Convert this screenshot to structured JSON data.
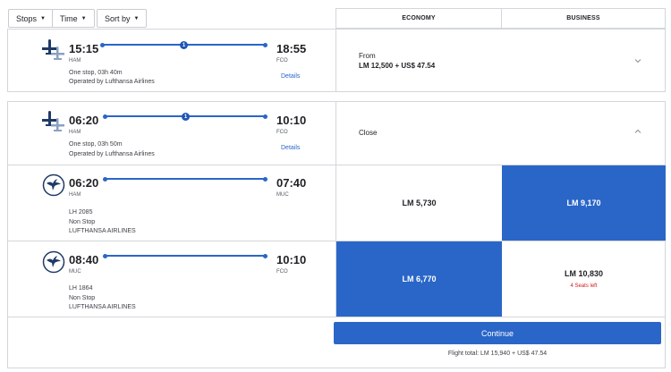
{
  "filters": {
    "stops_label": "Stops",
    "time_label": "Time",
    "sort_label": "Sort by"
  },
  "columns": {
    "economy": "ECONOMY",
    "business": "BUSINESS"
  },
  "flight1": {
    "depart_time": "15:15",
    "depart_code": "HAM",
    "arrive_time": "18:55",
    "arrive_code": "FCO",
    "stops_count": "1",
    "summary": "One stop, 03h 40m",
    "operator": "Operated by Lufthansa Airlines",
    "details_link": "Details",
    "from_label": "From",
    "from_price": "LM 12,500 + US$ 47.54"
  },
  "flight2": {
    "depart_time": "06:20",
    "depart_code": "HAM",
    "arrive_time": "10:10",
    "arrive_code": "FCO",
    "stops_count": "1",
    "summary": "One stop, 03h 50m",
    "operator": "Operated by Lufthansa Airlines",
    "details_link": "Details",
    "close_label": "Close"
  },
  "segments": [
    {
      "depart_time": "06:20",
      "depart_code": "HAM",
      "arrive_time": "07:40",
      "arrive_code": "MUC",
      "flight_no": "LH 2085",
      "stop_text": "Non Stop",
      "airline": "LUFTHANSA AIRLINES",
      "economy_price": "LM 5,730",
      "business_price": "LM 9,170",
      "selected": "business"
    },
    {
      "depart_time": "08:40",
      "depart_code": "MUC",
      "arrive_time": "10:10",
      "arrive_code": "FCO",
      "flight_no": "LH 1864",
      "stop_text": "Non Stop",
      "airline": "LUFTHANSA AIRLINES",
      "economy_price": "LM 6,770",
      "business_price": "LM 10,830",
      "business_seats": "4 Seats left",
      "selected": "economy"
    }
  ],
  "footer": {
    "continue_label": "Continue",
    "total_text": "Flight total: LM 15,940 + US$ 47.54"
  },
  "colors": {
    "accent": "#2a66c8",
    "seats_warning": "#d31a1a",
    "border": "#d3d6da"
  },
  "icons": [
    "caret-down-icon",
    "planes-icon",
    "lufthansa-crane-icon",
    "chevron-down-icon",
    "chevron-up-icon"
  ]
}
